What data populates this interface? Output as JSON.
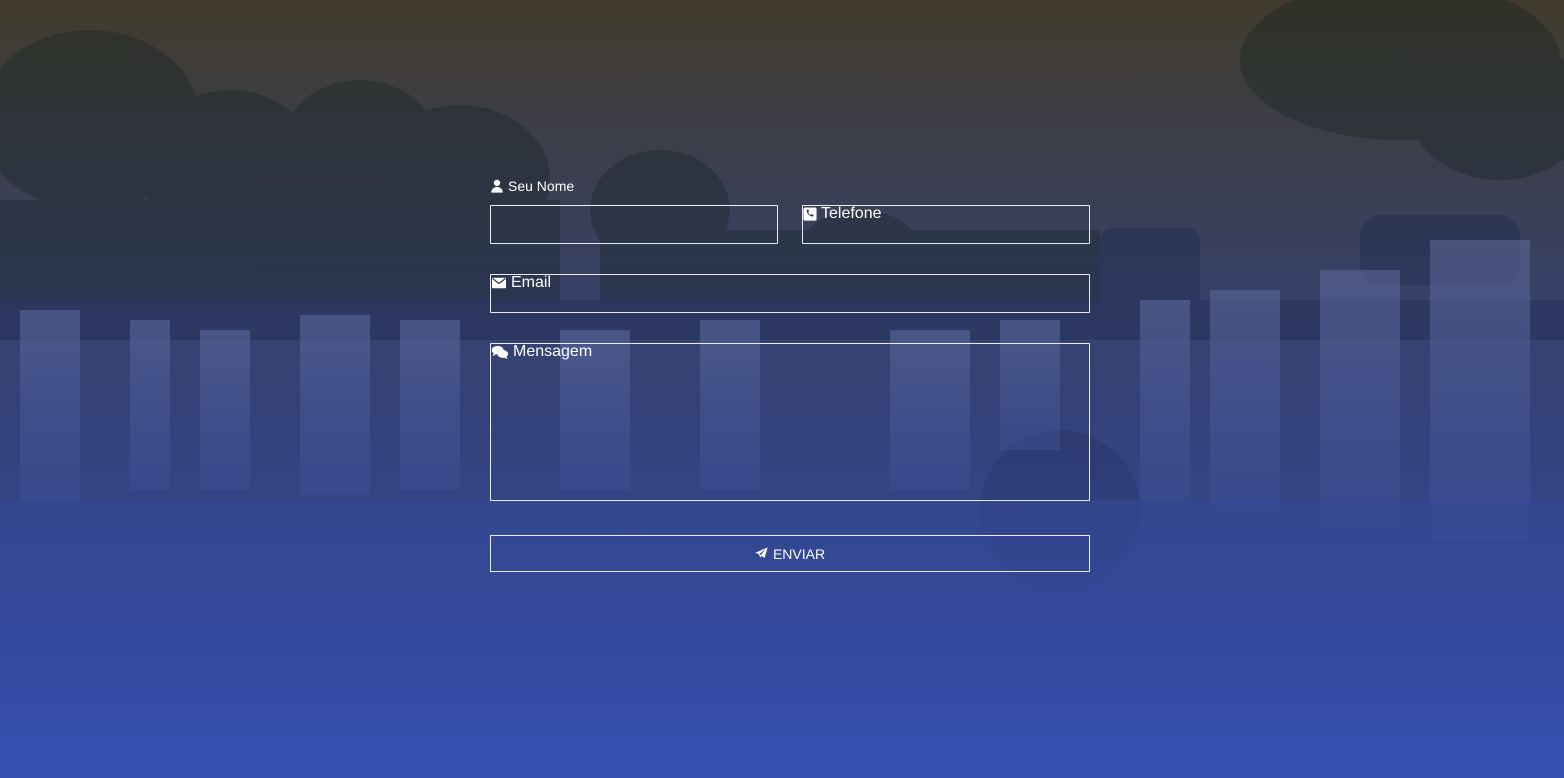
{
  "colors": {
    "overlay_top": "#3a3526",
    "overlay_bottom": "#3650b4",
    "border": "#ffffff",
    "text": "#ffffff"
  },
  "form": {
    "name": {
      "label": "Seu Nome",
      "icon": "user-icon",
      "value": ""
    },
    "phone": {
      "label": "Telefone",
      "icon": "phone-icon",
      "value": ""
    },
    "email": {
      "label": "Email",
      "icon": "envelope-icon",
      "value": ""
    },
    "message": {
      "label": "Mensagem",
      "icon": "comments-icon",
      "value": ""
    },
    "submit": {
      "label": "ENVIAR",
      "icon": "paper-plane-icon"
    }
  }
}
